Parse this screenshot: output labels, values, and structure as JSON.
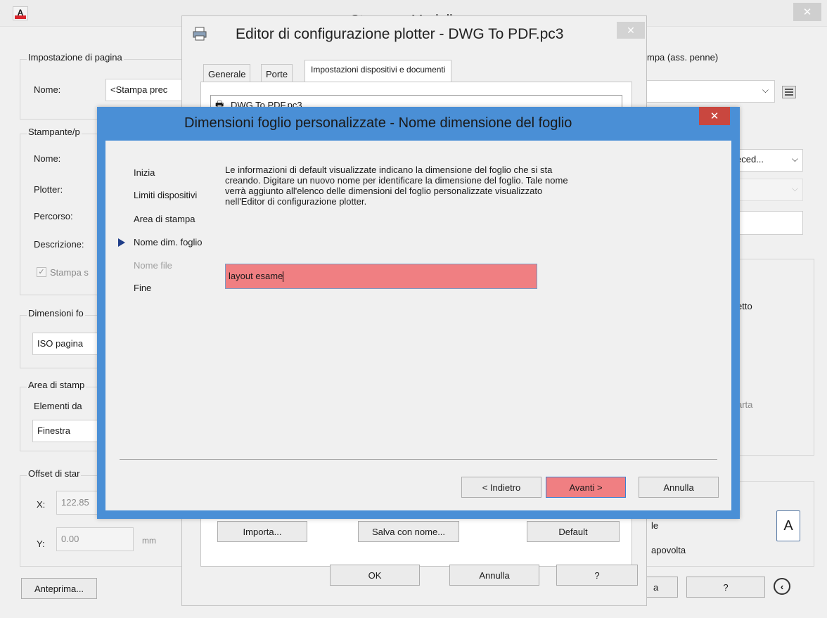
{
  "outer": {
    "title": "Stampa - Modello",
    "page_setup": {
      "label": "Impostazione di pagina",
      "name_label": "Nome:",
      "name_value": "<Stampa prec"
    },
    "printer": {
      "label": "Stampante/p",
      "name_label": "Nome:",
      "plotter_label": "Plotter:",
      "path_label": "Percorso:",
      "desc_label": "Descrizione:",
      "print_to_file": "Stampa s"
    },
    "paper_size": {
      "label": "Dimensioni fo",
      "value": "ISO pagina"
    },
    "print_area": {
      "label": "Area di stamp",
      "what_label": "Elementi da",
      "value": "Finestra"
    },
    "offset": {
      "label": "Offset di star",
      "x_label": "X:",
      "x_value": "122.85",
      "y_label": "Y:",
      "y_value": "0.00",
      "unit": "mm"
    },
    "preview_button": "Anteprima...",
    "right": {
      "style_label": "mpa (ass. penne)",
      "style_select": "",
      "prev_select": "eced...",
      "scale_text": "etto",
      "paper_text": "arta",
      "orient_text1": "le",
      "orient_text2": "apovolta",
      "orient_icon_letter": "A",
      "help_button": "?",
      "ok_button_partial": "a"
    }
  },
  "plotter_dialog": {
    "title": "Editor di configurazione plotter - DWG To PDF.pc3",
    "tabs": [
      "Generale",
      "Porte",
      "Impostazioni dispositivi e documenti"
    ],
    "tree_text": "DWG To PDF.pc3",
    "import_button": "Importa...",
    "save_as_button": "Salva con nome...",
    "default_button": "Default",
    "ok_button": "OK",
    "cancel_button": "Annulla",
    "help_button": "?"
  },
  "wizard": {
    "title": "Dimensioni foglio personalizzate - Nome dimensione del foglio",
    "steps": [
      {
        "label": "Inizia",
        "state": "normal"
      },
      {
        "label": "Limiti dispositivi",
        "state": "normal"
      },
      {
        "label": "Area di stampa",
        "state": "normal"
      },
      {
        "label": "Nome dim. foglio",
        "state": "current"
      },
      {
        "label": "Nome file",
        "state": "disabled"
      },
      {
        "label": "Fine",
        "state": "normal"
      }
    ],
    "description": "Le informazioni di default visualizzate indicano la dimensione del foglio che si sta creando. Digitare un nuovo nome per identificare la dimensione del foglio. Tale nome verrà aggiunto all'elenco delle dimensioni del foglio personalizzate visualizzato nell'Editor di configurazione plotter.",
    "name_input_value": "layout esame",
    "back_button": "< Indietro",
    "next_button": "Avanti >",
    "cancel_button": "Annulla",
    "colors": {
      "frame": "#4a8fd6",
      "close": "#c9473f",
      "highlight": "#f07f82"
    }
  }
}
